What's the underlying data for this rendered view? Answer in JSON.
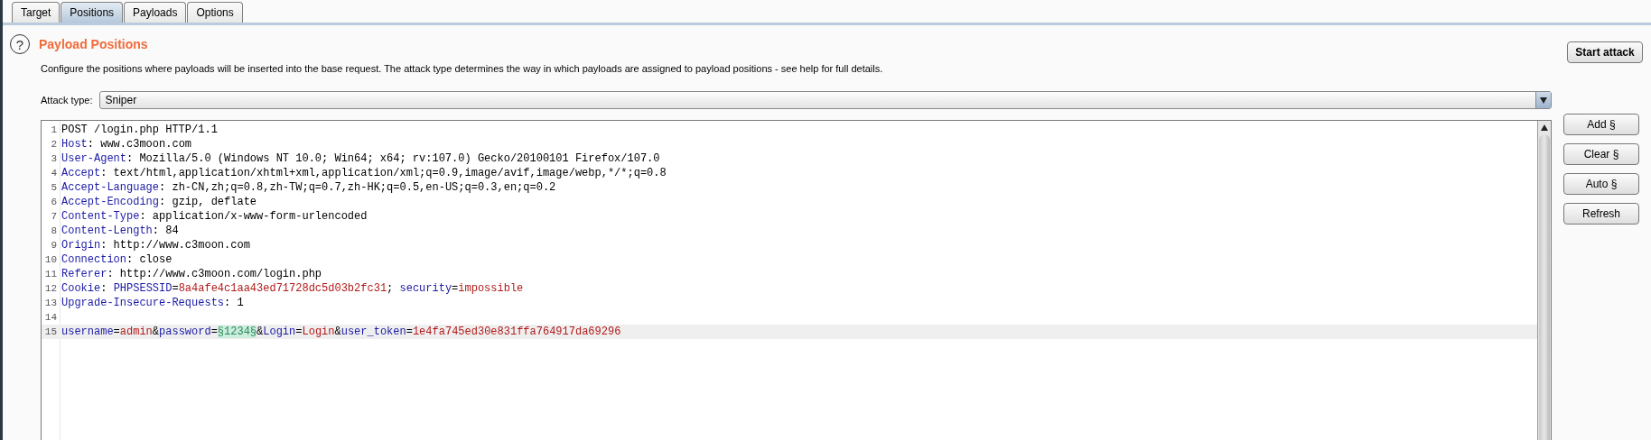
{
  "tabs": [
    {
      "label": "Target",
      "selected": false
    },
    {
      "label": "Positions",
      "selected": true
    },
    {
      "label": "Payloads",
      "selected": false
    },
    {
      "label": "Options",
      "selected": false
    }
  ],
  "help_icon": "?",
  "title": "Payload Positions",
  "description": "Configure the positions where payloads will be inserted into the base request. The attack type determines the way in which payloads are assigned to payload positions - see help for full details.",
  "start_button": "Start attack",
  "attack_type": {
    "label": "Attack type:",
    "value": "Sniper"
  },
  "editor": {
    "lines": [
      {
        "number": "1",
        "highlighted": false,
        "segments": [
          {
            "kind": "text",
            "text": "POST /login.php HTTP/1.1"
          }
        ]
      },
      {
        "number": "2",
        "highlighted": false,
        "segments": [
          {
            "kind": "key",
            "text": "Host"
          },
          {
            "kind": "text",
            "text": ": www.c3moon.com"
          }
        ]
      },
      {
        "number": "3",
        "highlighted": false,
        "segments": [
          {
            "kind": "key",
            "text": "User-Agent"
          },
          {
            "kind": "text",
            "text": ": Mozilla/5.0 (Windows NT 10.0; Win64; x64; rv:107.0) Gecko/20100101 Firefox/107.0"
          }
        ]
      },
      {
        "number": "4",
        "highlighted": false,
        "segments": [
          {
            "kind": "key",
            "text": "Accept"
          },
          {
            "kind": "text",
            "text": ": text/html,application/xhtml+xml,application/xml;q=0.9,image/avif,image/webp,*/*;q=0.8"
          }
        ]
      },
      {
        "number": "5",
        "highlighted": false,
        "segments": [
          {
            "kind": "key",
            "text": "Accept-Language"
          },
          {
            "kind": "text",
            "text": ": zh-CN,zh;q=0.8,zh-TW;q=0.7,zh-HK;q=0.5,en-US;q=0.3,en;q=0.2"
          }
        ]
      },
      {
        "number": "6",
        "highlighted": false,
        "segments": [
          {
            "kind": "key",
            "text": "Accept-Encoding"
          },
          {
            "kind": "text",
            "text": ": gzip, deflate"
          }
        ]
      },
      {
        "number": "7",
        "highlighted": false,
        "segments": [
          {
            "kind": "key",
            "text": "Content-Type"
          },
          {
            "kind": "text",
            "text": ": application/x-www-form-urlencoded"
          }
        ]
      },
      {
        "number": "8",
        "highlighted": false,
        "segments": [
          {
            "kind": "key",
            "text": "Content-Length"
          },
          {
            "kind": "text",
            "text": ": 84"
          }
        ]
      },
      {
        "number": "9",
        "highlighted": false,
        "segments": [
          {
            "kind": "key",
            "text": "Origin"
          },
          {
            "kind": "text",
            "text": ": http://www.c3moon.com"
          }
        ]
      },
      {
        "number": "10",
        "highlighted": false,
        "segments": [
          {
            "kind": "key",
            "text": "Connection"
          },
          {
            "kind": "text",
            "text": ": close"
          }
        ]
      },
      {
        "number": "11",
        "highlighted": false,
        "segments": [
          {
            "kind": "key",
            "text": "Referer"
          },
          {
            "kind": "text",
            "text": ": http://www.c3moon.com/login.php"
          }
        ]
      },
      {
        "number": "12",
        "highlighted": false,
        "segments": [
          {
            "kind": "key",
            "text": "Cookie"
          },
          {
            "kind": "text",
            "text": ": "
          },
          {
            "kind": "key",
            "text": "PHPSESSID"
          },
          {
            "kind": "text",
            "text": "="
          },
          {
            "kind": "value",
            "text": "8a4afe4c1aa43ed71728dc5d03b2fc31"
          },
          {
            "kind": "text",
            "text": "; "
          },
          {
            "kind": "key",
            "text": "security"
          },
          {
            "kind": "text",
            "text": "="
          },
          {
            "kind": "value",
            "text": "impossible"
          }
        ]
      },
      {
        "number": "13",
        "highlighted": false,
        "segments": [
          {
            "kind": "key",
            "text": "Upgrade-Insecure-Requests"
          },
          {
            "kind": "text",
            "text": ": 1"
          }
        ]
      },
      {
        "number": "14",
        "highlighted": false
      },
      {
        "number": "15",
        "highlighted": true,
        "segments": [
          {
            "kind": "key",
            "text": "username"
          },
          {
            "kind": "text",
            "text": "="
          },
          {
            "kind": "value",
            "text": "admin"
          },
          {
            "kind": "text",
            "text": "&"
          },
          {
            "kind": "key",
            "text": "password"
          },
          {
            "kind": "text",
            "text": "="
          },
          {
            "kind": "payload",
            "text": "§1234§"
          },
          {
            "kind": "text",
            "text": "&"
          },
          {
            "kind": "key",
            "text": "Login"
          },
          {
            "kind": "text",
            "text": "="
          },
          {
            "kind": "value",
            "text": "Login"
          },
          {
            "kind": "text",
            "text": "&"
          },
          {
            "kind": "key",
            "text": "user_token"
          },
          {
            "kind": "text",
            "text": "="
          },
          {
            "kind": "value",
            "text": "1e4fa745ed30e831ffa764917da69296"
          }
        ]
      }
    ]
  },
  "side_buttons": [
    "Add §",
    "Clear §",
    "Auto §",
    "Refresh"
  ]
}
